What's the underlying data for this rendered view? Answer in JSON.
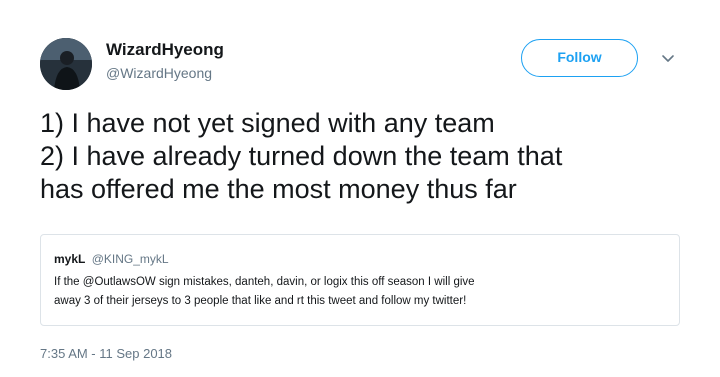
{
  "author": {
    "display_name": "WizardHyeong",
    "handle": "@WizardHyeong",
    "avatar_icon": "profile-photo"
  },
  "follow_button": {
    "label": "Follow",
    "color": "#1da1f2"
  },
  "menu": {
    "icon": "chevron-down-icon"
  },
  "tweet": {
    "lines": [
      "1) I have not yet signed with any team",
      "2) I have already turned down the team that",
      "has offered me the most money thus far"
    ]
  },
  "quoted_tweet": {
    "display_name": "mykL",
    "handle": "@KING_mykL",
    "lines": [
      "If the @OutlawsOW sign mistakes, danteh, davin, or logix this off season I will give",
      "away 3 of their jerseys to 3 people that like and rt this tweet and follow my twitter!"
    ]
  },
  "timestamp": "7:35 AM - 11 Sep 2018",
  "colors": {
    "text": "#14171a",
    "secondary": "#657786",
    "border": "#dde3e8",
    "accent": "#1da1f2"
  }
}
